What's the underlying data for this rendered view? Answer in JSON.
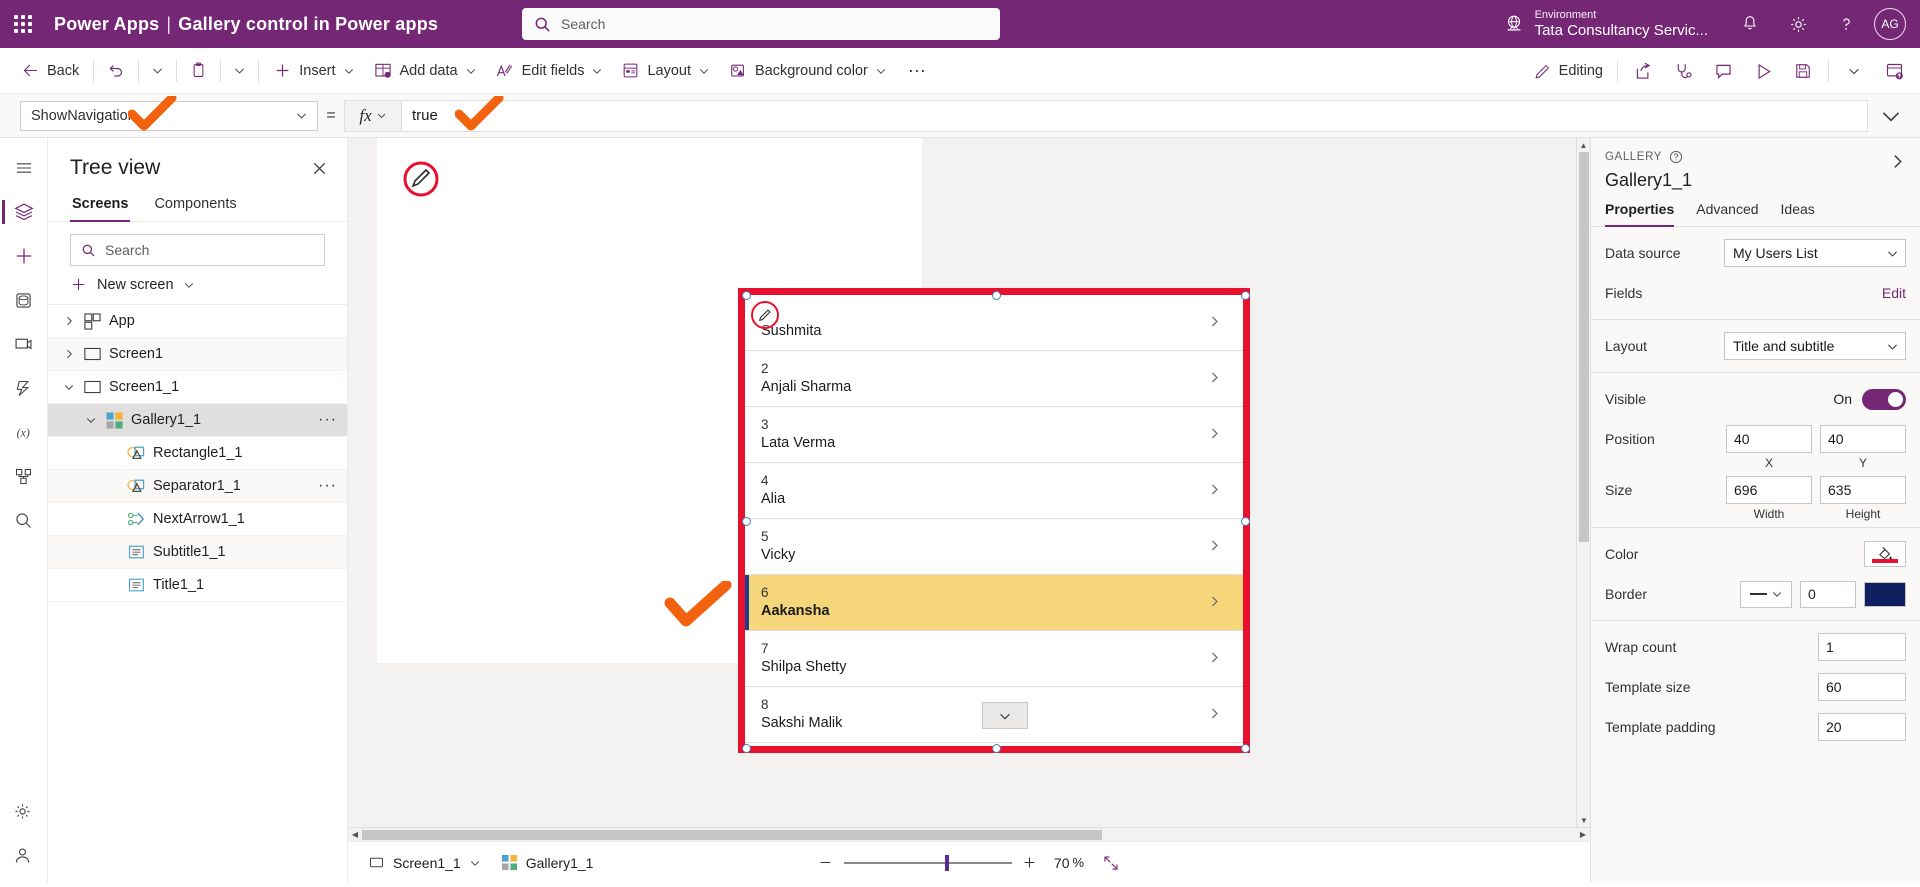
{
  "brand": {
    "app_name": "Power Apps",
    "separator": "|",
    "doc_title": "Gallery control in Power apps",
    "waffle_icon": "waffle-grid-icon",
    "environment_label": "Environment",
    "environment_name": "Tata Consultancy Servic...",
    "globe_icon": "environment-globe-icon",
    "notifications_icon": "bell-icon",
    "settings_icon": "gear-icon",
    "help_icon": "question-mark-icon",
    "avatar_initials": "AG"
  },
  "search": {
    "placeholder": "Search",
    "icon": "search-icon"
  },
  "command_bar": {
    "back": "Back",
    "back_icon": "arrow-left-icon",
    "undo_icon": "undo-icon",
    "paste_icon": "clipboard-icon",
    "insert": "Insert",
    "insert_icon": "plus-icon",
    "add_data": "Add data",
    "add_data_icon": "database-table-icon",
    "edit_fields": "Edit fields",
    "edit_fields_icon": "edit-fields-icon",
    "layout": "Layout",
    "layout_icon": "layout-icon",
    "background_color": "Background color",
    "background_color_icon": "paint-bucket-icon",
    "overflow": "···",
    "editing": "Editing",
    "editing_icon": "pencil-icon",
    "share_icon": "share-icon",
    "app-checker_icon": "stethoscope-icon",
    "comments_icon": "comment-icon",
    "preview_icon": "play-triangle-icon",
    "save_icon": "save-disk-icon",
    "save_chevron_icon": "chevron-down-icon",
    "publish_icon": "publish-cloud-icon"
  },
  "formula_bar": {
    "property": "ShowNavigation",
    "equals": "=",
    "fx_label": "fx",
    "value": "true",
    "expand_icon": "chevron-down-icon"
  },
  "left_rail": {
    "items": [
      {
        "name": "hamburger-menu-icon"
      },
      {
        "name": "tree-view-layers-icon",
        "active": true
      },
      {
        "name": "insert-plus-icon"
      },
      {
        "name": "data-cylinder-icon"
      },
      {
        "name": "media-icon"
      },
      {
        "name": "power-automate-icon"
      },
      {
        "name": "variables-fx-icon"
      },
      {
        "name": "components-icon"
      },
      {
        "name": "app-checker-search-icon"
      }
    ],
    "bottom": [
      {
        "name": "settings-gear-icon"
      },
      {
        "name": "account-person-icon"
      }
    ]
  },
  "tree_view": {
    "title": "Tree view",
    "close_icon": "close-x-icon",
    "tabs": [
      {
        "label": "Screens",
        "active": true
      },
      {
        "label": "Components",
        "active": false
      }
    ],
    "search_placeholder": "Search",
    "search_icon": "search-icon",
    "new_screen": "New screen",
    "new_screen_icon": "plus-icon",
    "nodes": [
      {
        "label": "App",
        "icon": "app-icon",
        "indent": 0,
        "twisty": "collapsed",
        "selected": false,
        "menu": false
      },
      {
        "label": "Screen1",
        "icon": "screen-rect-icon",
        "indent": 0,
        "twisty": "collapsed",
        "selected": false,
        "menu": false
      },
      {
        "label": "Screen1_1",
        "icon": "screen-rect-icon",
        "indent": 0,
        "twisty": "expanded",
        "selected": false,
        "menu": false
      },
      {
        "label": "Gallery1_1",
        "icon": "gallery-squares-icon",
        "indent": 1,
        "twisty": "expanded",
        "selected": true,
        "menu": true
      },
      {
        "label": "Rectangle1_1",
        "icon": "shapes-icon",
        "indent": 2,
        "twisty": "none",
        "selected": false,
        "menu": false
      },
      {
        "label": "Separator1_1",
        "icon": "shapes-icon",
        "indent": 2,
        "twisty": "none",
        "selected": false,
        "menu": true
      },
      {
        "label": "NextArrow1_1",
        "icon": "next-arrow-icon",
        "indent": 2,
        "twisty": "none",
        "selected": false,
        "menu": false
      },
      {
        "label": "Subtitle1_1",
        "icon": "label-text-icon",
        "indent": 2,
        "twisty": "none",
        "selected": false,
        "menu": false
      },
      {
        "label": "Title1_1",
        "icon": "label-text-icon",
        "indent": 2,
        "twisty": "none",
        "selected": false,
        "menu": false
      }
    ]
  },
  "gallery": {
    "chevron_icon": "chevron-right-icon",
    "edit_badge_icon": "pencil-edit-icon",
    "scroll_chip_icon": "chevron-down-icon",
    "rows": [
      {
        "num": "",
        "name": "Sushmita",
        "highlighted": false
      },
      {
        "num": "2",
        "name": "Anjali Sharma",
        "highlighted": false
      },
      {
        "num": "3",
        "name": "Lata Verma",
        "highlighted": false
      },
      {
        "num": "4",
        "name": "Alia",
        "highlighted": false
      },
      {
        "num": "5",
        "name": "Vicky",
        "highlighted": false
      },
      {
        "num": "6",
        "name": "Aakansha",
        "highlighted": true
      },
      {
        "num": "7",
        "name": "Shilpa Shetty",
        "highlighted": false
      },
      {
        "num": "8",
        "name": "Sakshi Malik",
        "highlighted": false
      }
    ]
  },
  "status_bar": {
    "screen_name": "Screen1_1",
    "screen_icon": "screen-rect-icon",
    "screen_chevron_icon": "chevron-down-icon",
    "control_name": "Gallery1_1",
    "control_icon": "gallery-squares-icon",
    "zoom_out_icon": "minus-icon",
    "zoom_in_icon": "plus-icon",
    "zoom_value": "70",
    "zoom_unit": "%",
    "fit_icon": "fit-screen-icon"
  },
  "properties_panel": {
    "kind": "GALLERY",
    "help_icon": "question-circle-icon",
    "collapse_icon": "chevron-right-icon",
    "control_name": "Gallery1_1",
    "tabs": [
      {
        "label": "Properties",
        "active": true
      },
      {
        "label": "Advanced",
        "active": false
      },
      {
        "label": "Ideas",
        "active": false
      }
    ],
    "data_source_label": "Data source",
    "data_source_value": "My Users List",
    "fields_label": "Fields",
    "fields_edit": "Edit",
    "layout_label": "Layout",
    "layout_value": "Title and subtitle",
    "visible_label": "Visible",
    "visible_state": "On",
    "position_label": "Position",
    "position_x": "40",
    "position_y": "40",
    "position_x_cap": "X",
    "position_y_cap": "Y",
    "size_label": "Size",
    "size_width": "696",
    "size_height": "635",
    "size_width_cap": "Width",
    "size_height_cap": "Height",
    "color_label": "Color",
    "color_value": "#e8112d",
    "border_label": "Border",
    "border_width": "0",
    "border_color": "#101f60",
    "wrap_count_label": "Wrap count",
    "wrap_count_value": "1",
    "template_size_label": "Template size",
    "template_size_value": "60",
    "template_padding_label": "Template padding",
    "template_padding_value": "20"
  },
  "colors": {
    "brand_purple": "#742774",
    "accent_purple": "#742774",
    "annotation_orange": "#f2620f",
    "gallery_border_red": "#e8112d",
    "highlight_yellow": "#f5d67b"
  }
}
